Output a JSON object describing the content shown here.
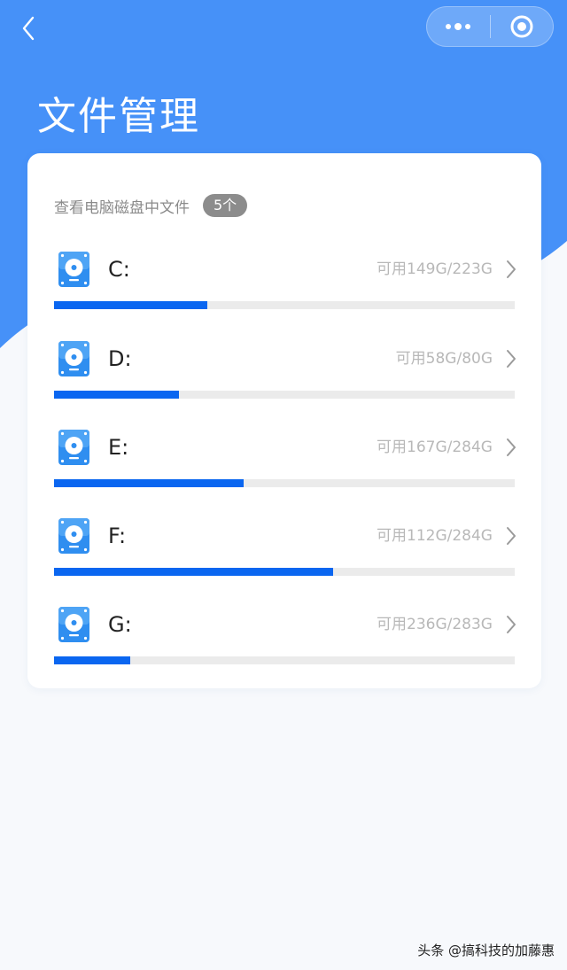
{
  "colors": {
    "header_blue": "#4691f8",
    "accent": "#0a66f0",
    "background": "#f7f9fc"
  },
  "nav": {
    "back_icon": "chevron-left-icon",
    "more_icon": "more-dots-icon",
    "close_icon": "target-circle-icon"
  },
  "page": {
    "title": "文件管理"
  },
  "card": {
    "subtitle": "查看电脑磁盘中文件",
    "count_badge": "5个"
  },
  "disks": [
    {
      "name": "C:",
      "capacity": "可用149G/223G",
      "used_fraction": 0.333
    },
    {
      "name": "D:",
      "capacity": "可用58G/80G",
      "used_fraction": 0.271
    },
    {
      "name": "E:",
      "capacity": "可用167G/284G",
      "used_fraction": 0.412
    },
    {
      "name": "F:",
      "capacity": "可用112G/284G",
      "used_fraction": 0.606
    },
    {
      "name": "G:",
      "capacity": "可用236G/283G",
      "used_fraction": 0.166
    }
  ],
  "watermark": "头条 @搞科技的加藤惠"
}
